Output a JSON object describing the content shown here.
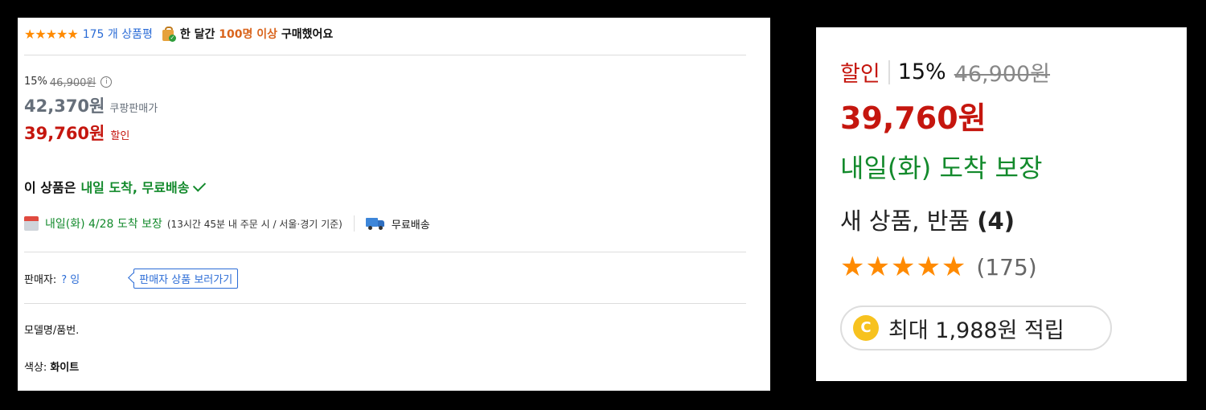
{
  "left": {
    "rating": {
      "stars": "★★★★★",
      "review_text": "175 개 상품평"
    },
    "purchase": {
      "prefix": "한 달간",
      "highlight": "100명 이상",
      "suffix": "구매했어요"
    },
    "original": {
      "discount": "15%",
      "price": "46,900원",
      "info_icon": "i"
    },
    "coupang": {
      "price": "42,370원",
      "label": "쿠팡판매가"
    },
    "sale": {
      "price": "39,760원",
      "label": "할인"
    },
    "delivery": {
      "headline_prefix": "이 상품은",
      "headline_green": "내일 도착, 무료배송"
    },
    "arrival": {
      "text": "내일(화) 4/28 도착 보장",
      "note": "(13시간 45분 내 주문 시 / 서울·경기 기준)"
    },
    "shipping": {
      "label": "무료배송"
    },
    "seller": {
      "label": "판매자:",
      "name": "?                    잉",
      "button": "판매자 상품 보러가기"
    },
    "model": {
      "label": "모델명/품번."
    },
    "color": {
      "label": "색상:",
      "value": "화이트"
    }
  },
  "right": {
    "sale_label": "할인",
    "discount": "15%",
    "original_price": "46,900원",
    "price": "39,760원",
    "arrival": "내일(화) 도착 보장",
    "return_text": "새 상품, 반품",
    "return_count": "(4)",
    "stars": "★★★★★",
    "review_count": "(175)",
    "coin": "C",
    "cashback": "최대 1,988원 적립"
  },
  "colors": {
    "sale_red": "#c5160e",
    "delivery_green": "#138a2c",
    "link_blue": "#2a6bd6",
    "star_orange": "#ff8a00",
    "coin_yellow": "#f7c21f"
  },
  "icons": [
    "star-icon",
    "shopping-bag-icon",
    "info-icon",
    "check-icon",
    "calendar-icon",
    "truck-icon",
    "coin-icon"
  ]
}
